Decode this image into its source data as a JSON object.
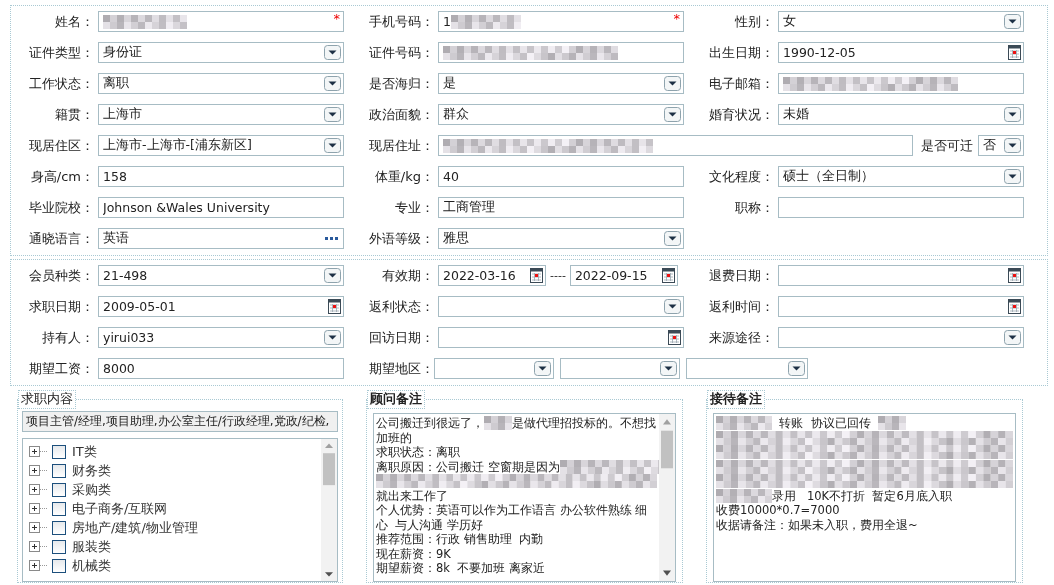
{
  "personal": {
    "rows": [
      [
        {
          "label": "姓名：",
          "kind": "text",
          "redacted": true,
          "required_mark": "*"
        },
        {
          "label": "手机号码：",
          "kind": "text",
          "value": "1",
          "redacted": true,
          "required_mark": "*"
        },
        {
          "label": "性别：",
          "kind": "select",
          "value": "女"
        }
      ],
      [
        {
          "label": "证件类型：",
          "kind": "select",
          "value": "身份证"
        },
        {
          "label": "证件号码：",
          "kind": "text",
          "redacted": true
        },
        {
          "label": "出生日期：",
          "kind": "date",
          "value": "1990-12-05"
        }
      ],
      [
        {
          "label": "工作状态：",
          "kind": "select",
          "value": "离职"
        },
        {
          "label": "是否海归：",
          "kind": "select",
          "value": "是"
        },
        {
          "label": "电子邮箱：",
          "kind": "text",
          "redacted": true
        }
      ],
      [
        {
          "label": "籍贯：",
          "kind": "select",
          "value": "上海市"
        },
        {
          "label": "政治面貌：",
          "kind": "select",
          "value": "群众"
        },
        {
          "label": "婚育状况：",
          "kind": "select",
          "value": "未婚"
        }
      ],
      [
        {
          "label": "现居住区：",
          "kind": "select",
          "value": "上海市-上海市-[浦东新区]"
        },
        {
          "label": "现居住址：",
          "kind": "address",
          "redacted": true,
          "extra": {
            "label": "是否可迁",
            "value": "否"
          }
        }
      ],
      [
        {
          "label": "身高/cm：",
          "kind": "text",
          "value": "158"
        },
        {
          "label": "体重/kg：",
          "kind": "text",
          "value": "40"
        },
        {
          "label": "文化程度：",
          "kind": "select",
          "value": "硕士（全日制）"
        }
      ],
      [
        {
          "label": "毕业院校：",
          "kind": "text",
          "value": "Johnson &Wales University"
        },
        {
          "label": "专业：",
          "kind": "text",
          "value": "工商管理"
        },
        {
          "label": "职称：",
          "kind": "text"
        }
      ],
      [
        {
          "label": "通晓语言：",
          "kind": "picker",
          "value": "英语"
        },
        {
          "label": "外语等级：",
          "kind": "select",
          "value": "雅思"
        }
      ]
    ]
  },
  "membership": {
    "rows": [
      [
        {
          "label": "会员种类：",
          "kind": "select",
          "value": "21-498"
        },
        {
          "label": "有效期：",
          "kind": "daterange",
          "value": "2022-03-16",
          "separator": "----",
          "value_end": "2022-09-15"
        },
        {
          "label": "退费日期：",
          "kind": "date"
        }
      ],
      [
        {
          "label": "求职日期：",
          "kind": "date",
          "value": "2009-05-01"
        },
        {
          "label": "返利状态：",
          "kind": "select"
        },
        {
          "label": "返利时间：",
          "kind": "date"
        }
      ],
      [
        {
          "label": "持有人：",
          "kind": "select",
          "value": "yirui033"
        },
        {
          "label": "回访日期：",
          "kind": "date"
        },
        {
          "label": "来源途径：",
          "kind": "select"
        }
      ],
      [
        {
          "label": "期望工资：",
          "kind": "text",
          "value": "8000"
        },
        {
          "label": "期望地区：",
          "kind": "region"
        }
      ]
    ]
  },
  "job_intent": {
    "legend": "求职内容",
    "bold": false,
    "selected_text": "项目主管/经理,项目助理,办公室主任/行政经理,党政/纪检,",
    "categories": [
      {
        "label": "IT类",
        "checked": false,
        "expanded": false
      },
      {
        "label": "财务类",
        "checked": false,
        "expanded": false
      },
      {
        "label": "采购类",
        "checked": false,
        "expanded": false
      },
      {
        "label": "电子商务/互联网",
        "checked": false,
        "expanded": false
      },
      {
        "label": "房地产/建筑/物业管理",
        "checked": false,
        "expanded": false
      },
      {
        "label": "服装类",
        "checked": false,
        "expanded": false
      },
      {
        "label": "机械类",
        "checked": false,
        "expanded": false
      }
    ]
  },
  "notes": [
    {
      "legend": "顾问备注",
      "bold": true,
      "has_scrollbar": true,
      "lines": [
        {
          "parts": [
            {
              "text": "公司搬迁到很远了，"
            },
            {
              "redacted": true
            },
            {
              "text": "是做代理招投标的。不想找"
            }
          ]
        },
        {
          "parts": [
            {
              "text": "加班的"
            }
          ]
        },
        {
          "parts": [
            {
              "text": "求职状态：离职"
            }
          ]
        },
        {
          "parts": [
            {
              "text": "离职原因：公司搬迁 空窗期是因为"
            },
            {
              "redacted": true
            }
          ]
        },
        {
          "parts": [
            {
              "redacted": true
            }
          ]
        },
        {
          "parts": [
            {
              "text": "就出来工作了"
            }
          ]
        },
        {
          "parts": [
            {
              "text": "个人优势：英语可以作为工作语言 办公软件熟练 细"
            }
          ]
        },
        {
          "parts": [
            {
              "text": "心  与人沟通 学历好"
            }
          ]
        },
        {
          "parts": [
            {
              "text": "推荐范围：行政 销售助理  内勤"
            }
          ]
        },
        {
          "parts": [
            {
              "text": "现在薪资：9K"
            }
          ]
        },
        {
          "parts": [
            {
              "text": "期望薪资：8k  不要加班 离家近"
            }
          ]
        }
      ]
    },
    {
      "legend": "接待备注",
      "bold": true,
      "has_scrollbar": false,
      "lines": [
        {
          "parts": [
            {
              "redacted": true
            },
            {
              "text": "  转账  协议已回传  "
            },
            {
              "redacted": true
            }
          ]
        },
        {
          "parts": [
            {
              "redacted": true
            }
          ]
        },
        {
          "parts": [
            {
              "redacted": true
            }
          ]
        },
        {
          "parts": [
            {
              "redacted": true
            }
          ]
        },
        {
          "parts": [
            {
              "redacted": true
            }
          ]
        },
        {
          "parts": [
            {
              "redacted": true
            },
            {
              "text": "录用   10K不打折  暂定6月底入职"
            }
          ]
        },
        {
          "parts": [
            {
              "text": "收费10000*0.7=7000"
            }
          ]
        },
        {
          "parts": [
            {
              "text": "收据请备注：如果未入职，费用全退~"
            }
          ]
        }
      ]
    }
  ]
}
